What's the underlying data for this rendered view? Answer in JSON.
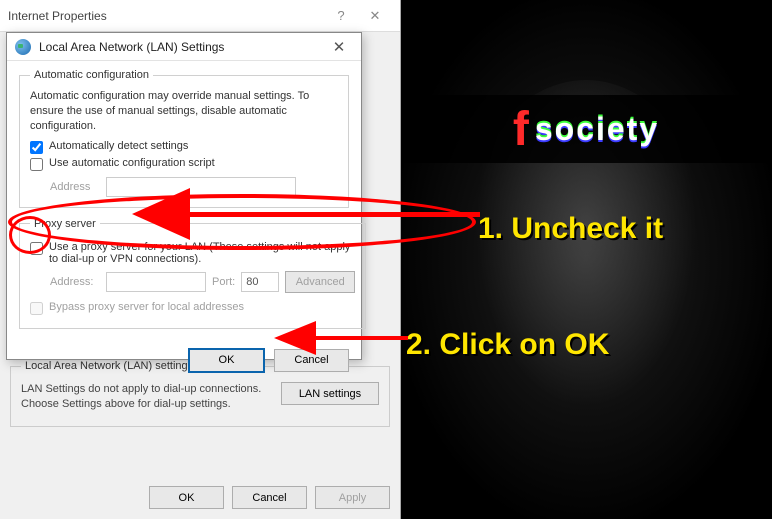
{
  "parent_window": {
    "title": "Internet Properties",
    "lan_section": {
      "legend": "Local Area Network (LAN) settings",
      "text": "LAN Settings do not apply to dial-up connections. Choose Settings above for dial-up settings.",
      "button": "LAN settings"
    },
    "buttons": {
      "ok": "OK",
      "cancel": "Cancel",
      "apply": "Apply"
    }
  },
  "dialog": {
    "title": "Local Area Network (LAN) Settings",
    "auto": {
      "legend": "Automatic configuration",
      "desc": "Automatic configuration may override manual settings.  To ensure the use of manual settings, disable automatic configuration.",
      "detect": {
        "label": "Automatically detect settings",
        "checked": true
      },
      "script": {
        "label": "Use automatic configuration script",
        "checked": false
      },
      "address_label": "Address",
      "address_value": ""
    },
    "proxy": {
      "legend": "Proxy server",
      "use": {
        "label": "Use a proxy server for your LAN (These settings will not apply to dial-up or VPN connections).",
        "checked": false
      },
      "address_label": "Address:",
      "address_value": "",
      "port_label": "Port:",
      "port_value": "80",
      "advanced": "Advanced",
      "bypass": {
        "label": "Bypass proxy server for local addresses",
        "checked": false
      }
    },
    "buttons": {
      "ok": "OK",
      "cancel": "Cancel"
    }
  },
  "annotations": {
    "step1": "1. Uncheck it",
    "step2": "2. Click on OK",
    "logo_f": "f",
    "logo_rest": "society"
  }
}
